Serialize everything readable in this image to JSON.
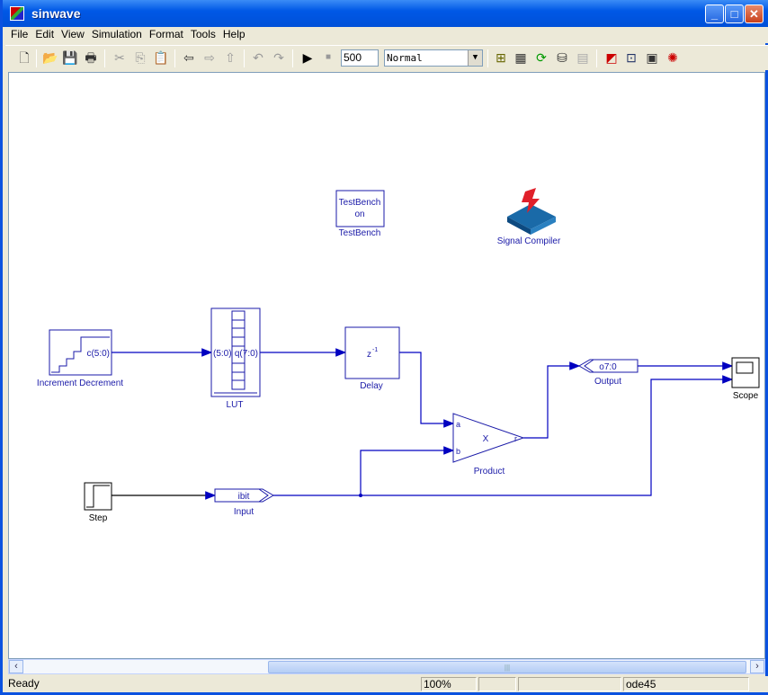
{
  "window": {
    "title": "sinwave"
  },
  "menu": [
    "File",
    "Edit",
    "View",
    "Simulation",
    "Format",
    "Tools",
    "Help"
  ],
  "toolbar": {
    "stop_time": "500",
    "sim_mode": "Normal"
  },
  "diagram": {
    "blocks": {
      "testbench": {
        "line1": "TestBench",
        "line2": "on",
        "label": "TestBench"
      },
      "signal_compiler": {
        "label": "Signal Compiler"
      },
      "counter": {
        "port": "c(5:0)",
        "label": "Increment Decrement"
      },
      "lut": {
        "in_port": "(5:0)",
        "out_port": "q(7:0)",
        "label": "LUT"
      },
      "delay": {
        "text": "z",
        "exp": "-1",
        "label": "Delay"
      },
      "product": {
        "a": "a",
        "b": "b",
        "op": "X",
        "out": "r",
        "label": "Product"
      },
      "output": {
        "text": "o7:0",
        "label": "Output"
      },
      "scope": {
        "label": "Scope"
      },
      "step": {
        "label": "Step"
      },
      "input": {
        "text": "ibit",
        "label": "Input"
      }
    },
    "colors": {
      "line": "#0000c0",
      "block": "#1a1aa8"
    }
  },
  "statusbar": {
    "status": "Ready",
    "zoom": "100%",
    "solver": "ode45"
  }
}
